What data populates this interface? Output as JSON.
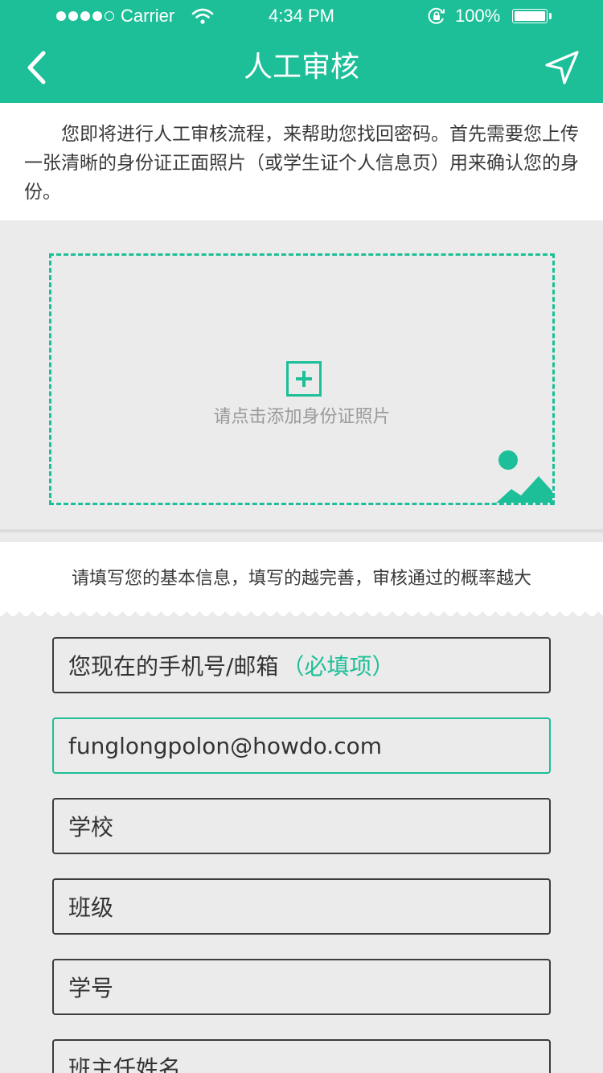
{
  "status_bar": {
    "carrier": "Carrier",
    "time": "4:34 PM",
    "battery": "100%",
    "signal_bars_filled": 4,
    "signal_bars_total": 5
  },
  "nav": {
    "title": "人工审核",
    "back_icon": "chevron-left-icon",
    "send_icon": "navigation-arrow-icon"
  },
  "intro": {
    "text": "您即将进行人工审核流程，来帮助您找回密码。首先需要您上传一张清晰的身份证正面照片（或学生证个人信息页）用来确认您的身份。"
  },
  "upload": {
    "hint": "请点击添加身份证照片",
    "add_icon": "plus-square-icon",
    "decor_icon": "picture-icon"
  },
  "info": {
    "hint": "请填写您的基本信息，填写的越完善，审核通过的概率越大"
  },
  "form": {
    "fields": [
      {
        "label": "您现在的手机号/邮箱",
        "required_tag": "（必填项）"
      },
      {
        "value": "funglongpolon@howdo.com"
      },
      {
        "label": "学校"
      },
      {
        "label": "班级"
      },
      {
        "label": "学号"
      },
      {
        "label": "班主任姓名"
      }
    ]
  },
  "colors": {
    "brand": "#1dbf98",
    "background": "#ebebeb",
    "card": "#ffffff",
    "field_border": "#3d3d3d"
  }
}
